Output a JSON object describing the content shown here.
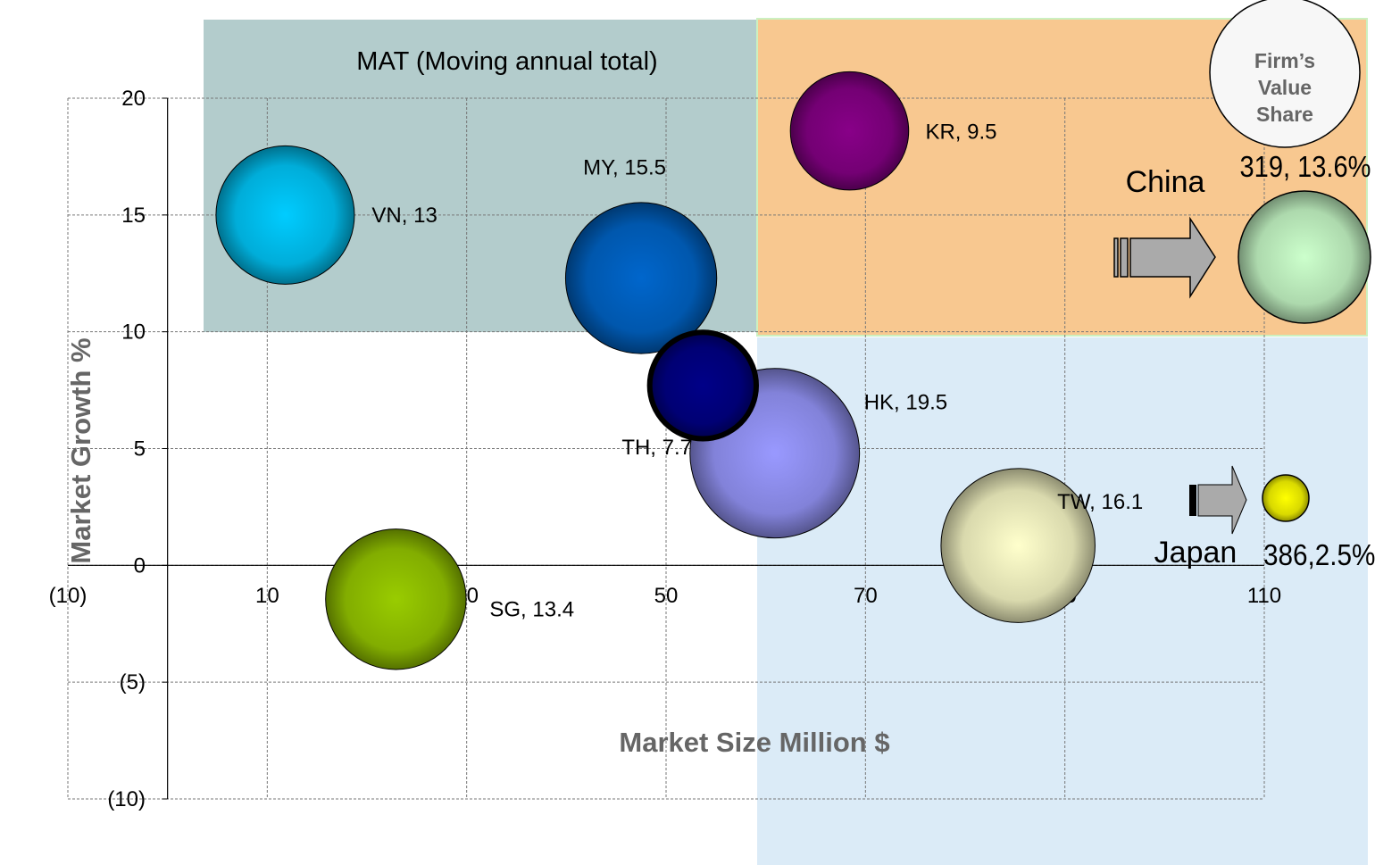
{
  "chart_data": {
    "type": "bubble",
    "xlabel": "Market Size Million $",
    "ylabel": "Market Growth %",
    "xlim": [
      -10,
      110
    ],
    "ylim": [
      -10,
      20
    ],
    "x_ticks": [
      -10,
      10,
      30,
      50,
      70,
      90,
      110
    ],
    "x_tick_labels": [
      "(10)",
      "10",
      "30",
      "50",
      "70",
      "90",
      "110"
    ],
    "y_ticks": [
      -10,
      -5,
      0,
      5,
      10,
      15,
      20
    ],
    "y_tick_labels": [
      "(10)",
      "(5)",
      "0",
      "5",
      "10",
      "15",
      "20"
    ],
    "grid": true,
    "series": [
      {
        "name": "VN",
        "x": 11.8,
        "y": 15.0,
        "size": 13,
        "label": "VN, 13",
        "color": "#00ccff"
      },
      {
        "name": "MY",
        "x": 47.5,
        "y": 12.3,
        "size": 15.5,
        "label": "MY, 15.5",
        "color": "#0066cc"
      },
      {
        "name": "KR",
        "x": 68.4,
        "y": 18.6,
        "size": 9.5,
        "label": "KR, 9.5",
        "color": "#880088"
      },
      {
        "name": "HK",
        "x": 60.9,
        "y": 4.8,
        "size": 19.5,
        "label": "HK, 19.5",
        "color": "#9999ff"
      },
      {
        "name": "TH",
        "x": 53.7,
        "y": 7.7,
        "size": 7.7,
        "label": "TH, 7.7",
        "color": "#000088"
      },
      {
        "name": "SG",
        "x": 22.9,
        "y": -1.45,
        "size": 13.4,
        "label": "SG, 13.4",
        "color": "#99cc00"
      },
      {
        "name": "TW",
        "x": 85.3,
        "y": 0.85,
        "size": 16.1,
        "label": "TW, 16.1",
        "color": "#ffffcc"
      }
    ],
    "regions": [
      {
        "label": "MAT (Moving annual total)",
        "color": "#b3cccc"
      },
      {
        "label": "",
        "color": "#f8c890"
      },
      {
        "label": "",
        "color": "#dbebf7"
      }
    ],
    "callouts": [
      {
        "name": "China",
        "label": "319, 13.6%",
        "value": 319,
        "share": 13.6,
        "color": "#ccffcc"
      },
      {
        "name": "Japan",
        "label": "386,2.5%",
        "value": 386,
        "share": 2.5,
        "color": "#ffff00"
      }
    ],
    "legend": {
      "label": "Firm’s Value Share",
      "lines": [
        "Firm’s",
        "Value",
        "Share"
      ],
      "position": "top-right"
    }
  }
}
